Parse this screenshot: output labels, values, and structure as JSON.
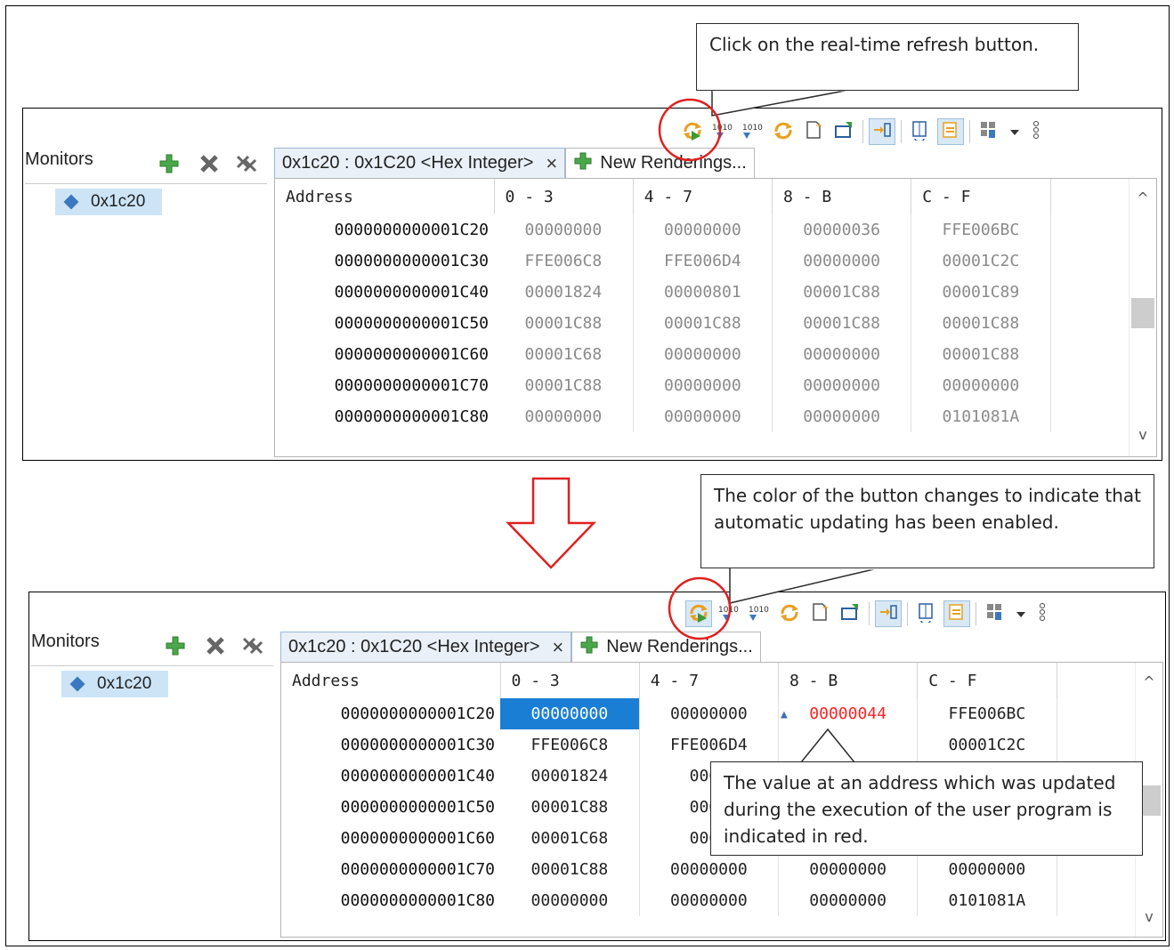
{
  "callouts": {
    "top": "Click on the real-time  refresh button.",
    "middle": "The color of the button changes to indicate that automatic updating has been enabled.",
    "bottom": "The value at an address which was updated during the execution of the user program is indicated in red."
  },
  "colors": {
    "highlight_circle": "#e02020",
    "arrow_outline": "#e02020",
    "changed_value": "#ff2222",
    "selection": "#1a7fd4"
  },
  "panel_top": {
    "monitors_label": "Monitors",
    "monitor_item": "0x1c20",
    "tab_rendering": "0x1c20 : 0x1C20 <Hex Integer>",
    "tab_new": "New Renderings...",
    "headers": [
      "Address",
      "0 - 3",
      "4 - 7",
      "8 - B",
      "C - F"
    ],
    "rows": [
      [
        "0000000000001C20",
        "00000000",
        "00000000",
        "00000036",
        "FFE006BC"
      ],
      [
        "0000000000001C30",
        "FFE006C8",
        "FFE006D4",
        "00000000",
        "00001C2C"
      ],
      [
        "0000000000001C40",
        "00001824",
        "00000801",
        "00001C88",
        "00001C89"
      ],
      [
        "0000000000001C50",
        "00001C88",
        "00001C88",
        "00001C88",
        "00001C88"
      ],
      [
        "0000000000001C60",
        "00001C68",
        "00000000",
        "00000000",
        "00001C88"
      ],
      [
        "0000000000001C70",
        "00001C88",
        "00000000",
        "00000000",
        "00000000"
      ],
      [
        "0000000000001C80",
        "00000000",
        "00000000",
        "00000000",
        "0101081A"
      ]
    ]
  },
  "panel_bottom": {
    "monitors_label": "Monitors",
    "monitor_item": "0x1c20",
    "tab_rendering": "0x1c20 : 0x1C20 <Hex Integer>",
    "tab_new": "New Renderings...",
    "headers": [
      "Address",
      "0 - 3",
      "4 - 7",
      "8 - B",
      "C - F"
    ],
    "rows": [
      [
        "0000000000001C20",
        "00000000",
        "00000000",
        "00000044",
        "FFE006BC"
      ],
      [
        "0000000000001C30",
        "FFE006C8",
        "FFE006D4",
        "",
        "00001C2C"
      ],
      [
        "0000000000001C40",
        "00001824",
        "0000",
        "",
        ""
      ],
      [
        "0000000000001C50",
        "00001C88",
        "0000",
        "",
        ""
      ],
      [
        "0000000000001C60",
        "00001C68",
        "0000",
        "",
        ""
      ],
      [
        "0000000000001C70",
        "00001C88",
        "00000000",
        "00000000",
        "00000000"
      ],
      [
        "0000000000001C80",
        "00000000",
        "00000000",
        "00000000",
        "0101081A"
      ]
    ]
  },
  "toolbar_icons": [
    "realtime-refresh-icon",
    "binary-import-icon",
    "binary-export-icon",
    "refresh-icon",
    "new-file-icon",
    "pin-icon",
    "link-icon",
    "columns-icon",
    "sync-icon",
    "layout-icon",
    "dropdown-icon",
    "more-icon"
  ]
}
